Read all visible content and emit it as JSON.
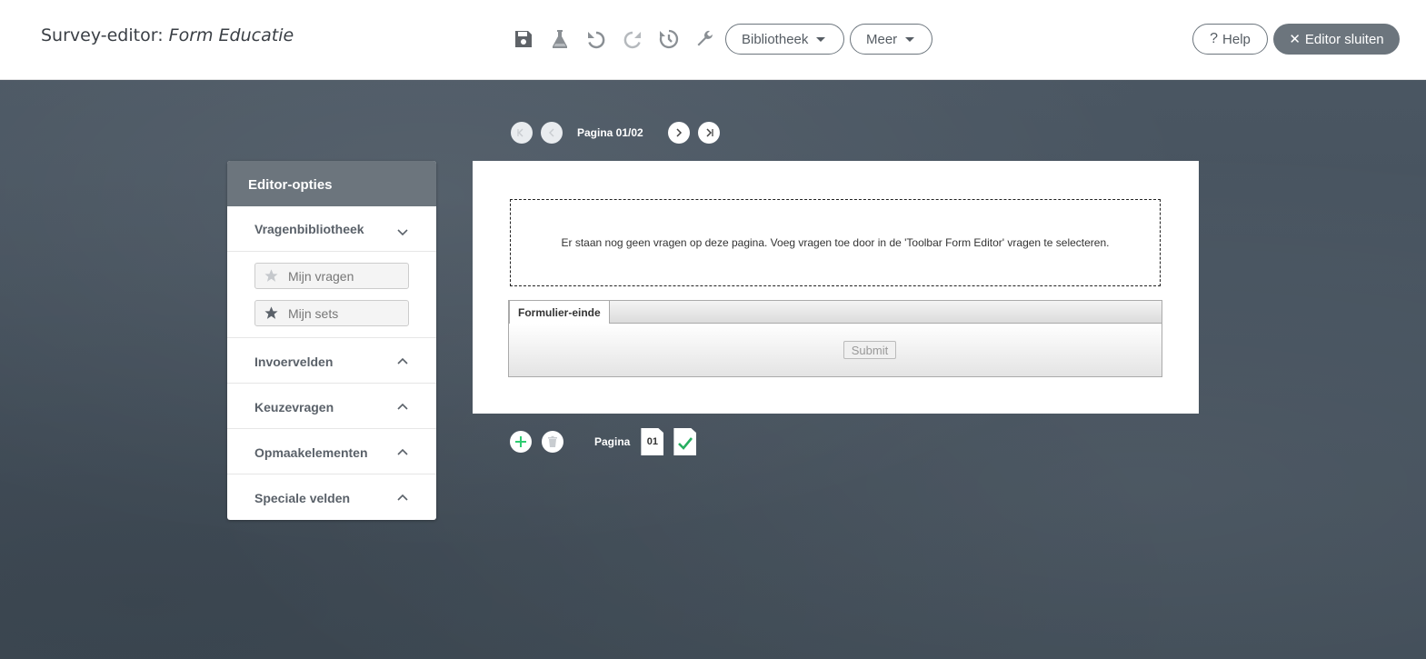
{
  "header": {
    "title_prefix": "Survey-editor: ",
    "form_name": "Form Educatie",
    "toolbar": {
      "icons": [
        "save-icon",
        "flask-icon",
        "undo-icon",
        "redo-icon",
        "history-icon",
        "wrench-icon"
      ],
      "library_label": "Bibliotheek",
      "more_label": "Meer",
      "help_label": "Help",
      "close_label": "Editor sluiten"
    }
  },
  "pager": {
    "label": "Pagina 01/02"
  },
  "sidebar": {
    "title": "Editor-opties",
    "library": {
      "label": "Vragenbibliotheek",
      "expanded": true,
      "buttons": [
        {
          "label": "Mijn vragen",
          "icon": "star-outline-icon"
        },
        {
          "label": "Mijn sets",
          "icon": "star-icon"
        }
      ]
    },
    "sections": [
      {
        "label": "Invoervelden"
      },
      {
        "label": "Keuzevragen"
      },
      {
        "label": "Opmaakelementen"
      },
      {
        "label": "Speciale velden"
      }
    ]
  },
  "canvas": {
    "empty_message": "Er staan nog geen vragen op deze pagina. Voeg vragen toe door in de 'Toolbar Form Editor' vragen te selecteren.",
    "end_tab_label": "Formulier-einde",
    "submit_label": "Submit"
  },
  "bottom": {
    "label": "Pagina",
    "page_numbers": [
      "01"
    ]
  },
  "colors": {
    "accent_gray": "#6c757d",
    "add_green": "#2ecc71",
    "check_green": "#27ae60"
  }
}
